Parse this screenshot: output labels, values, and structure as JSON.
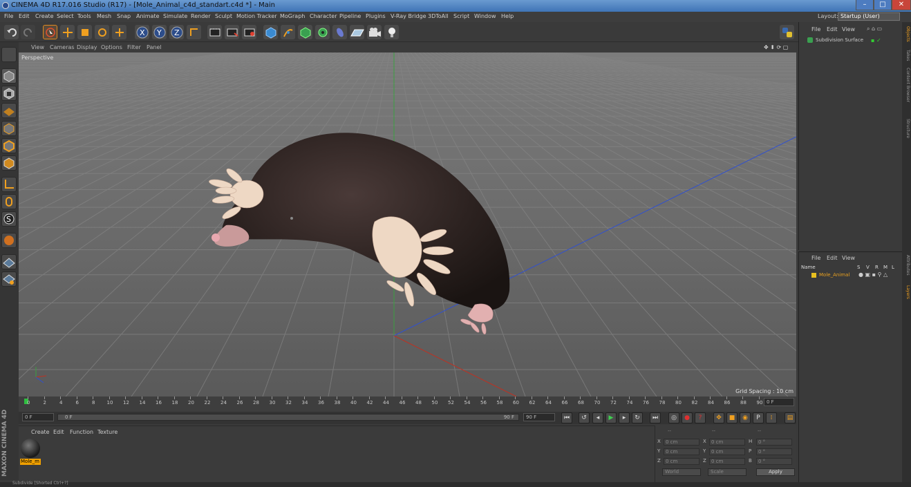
{
  "window": {
    "title": "CINEMA 4D R17.016 Studio (R17) - [Mole_Animal_c4d_standart.c4d *] - Main"
  },
  "menu": [
    "File",
    "Edit",
    "Create",
    "Select",
    "Tools",
    "Mesh",
    "Snap",
    "Animate",
    "Simulate",
    "Render",
    "Sculpt",
    "Motion Tracker",
    "MoGraph",
    "Character",
    "Pipeline",
    "Plugins",
    "V-Ray Bridge",
    "3DToAll",
    "Script",
    "Window",
    "Help"
  ],
  "layout": {
    "label": "Layout:",
    "value": "Startup (User)"
  },
  "viewport": {
    "menu": [
      "View",
      "Cameras",
      "Display",
      "Options",
      "Filter",
      "Panel"
    ],
    "label": "Perspective",
    "grid_spacing": "Grid Spacing : 10 cm"
  },
  "timeline": {
    "ticks": [
      "0",
      "2",
      "4",
      "6",
      "8",
      "10",
      "12",
      "14",
      "16",
      "18",
      "20",
      "22",
      "24",
      "26",
      "28",
      "30",
      "32",
      "34",
      "36",
      "38",
      "40",
      "42",
      "44",
      "46",
      "48",
      "50",
      "52",
      "54",
      "56",
      "58",
      "60",
      "62",
      "64",
      "66",
      "68",
      "70",
      "72",
      "74",
      "76",
      "78",
      "80",
      "82",
      "84",
      "86",
      "88",
      "90"
    ],
    "frame_field": "0 F"
  },
  "transport": {
    "start": "0 F",
    "slider_start": "0 F",
    "slider_end": "90 F",
    "end": "90 F"
  },
  "material_manager": {
    "menu": [
      "Create",
      "Edit",
      "Function",
      "Texture"
    ],
    "material_name": "Mole_m"
  },
  "coordinates": {
    "header": [
      "--",
      "--",
      "--"
    ],
    "rows": [
      {
        "a": "X",
        "av": "0 cm",
        "b": "X",
        "bv": "0 cm",
        "c": "H",
        "cv": "0 °"
      },
      {
        "a": "Y",
        "av": "0 cm",
        "b": "Y",
        "bv": "0 cm",
        "c": "P",
        "cv": "0 °"
      },
      {
        "a": "Z",
        "av": "0 cm",
        "b": "Z",
        "bv": "0 cm",
        "c": "B",
        "cv": "0 °"
      }
    ],
    "mode1": "World",
    "mode2": "Scale",
    "apply": "Apply"
  },
  "object_manager": {
    "menu": [
      "File",
      "Edit",
      "View"
    ],
    "object": "Subdivision Surface"
  },
  "layer_manager": {
    "menu": [
      "File",
      "Edit",
      "View"
    ],
    "cols": [
      "Name",
      "S",
      "V",
      "R",
      "M",
      "L"
    ],
    "layer": "Mole_Animal"
  },
  "side_tabs": [
    "Objects",
    "Takes",
    "Content Browser",
    "Structure",
    "Attributes",
    "Layers"
  ],
  "status": "Subdivide [Shorted Ctrl+?]",
  "brand": "MAXON CINEMA 4D",
  "colors": {
    "accent": "#f0a000",
    "highlight": "#e8a020",
    "bg": "#3a3a3a"
  }
}
